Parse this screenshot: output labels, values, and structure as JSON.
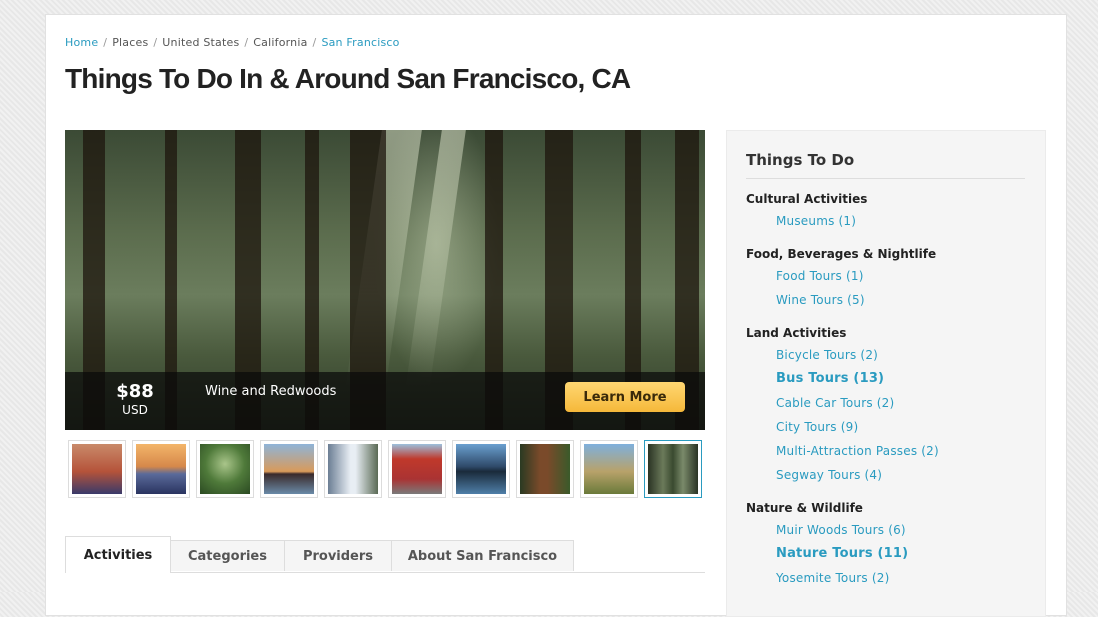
{
  "breadcrumb": {
    "home": "Home",
    "places": "Places",
    "country": "United States",
    "state": "California",
    "city": "San Francisco",
    "separator": "/"
  },
  "page_title": "Things To Do In & Around San Francisco, CA",
  "hero": {
    "price": "$88",
    "currency": "USD",
    "name": "Wine and Redwoods",
    "button_label": "Learn More"
  },
  "thumbnails": [
    {
      "name": "golden-gate-sunset"
    },
    {
      "name": "bay-sunset"
    },
    {
      "name": "forest-tree"
    },
    {
      "name": "bay-bridge"
    },
    {
      "name": "yosemite-falls"
    },
    {
      "name": "cable-car-trolley"
    },
    {
      "name": "mountain-lake"
    },
    {
      "name": "redwood-trail"
    },
    {
      "name": "vineyard-hills"
    },
    {
      "name": "redwood-forest",
      "active": true
    }
  ],
  "tabs": [
    "Activities",
    "Categories",
    "Providers",
    "About San Francisco"
  ],
  "sidebar": {
    "title": "Things To Do",
    "categories": [
      {
        "label": "Cultural Activities",
        "items": [
          {
            "label": "Museums (1)"
          }
        ]
      },
      {
        "label": "Food, Beverages & Nightlife",
        "items": [
          {
            "label": "Food Tours (1)"
          },
          {
            "label": "Wine Tours (5)"
          }
        ]
      },
      {
        "label": "Land Activities",
        "items": [
          {
            "label": "Bicycle Tours (2)"
          },
          {
            "label": "Bus Tours (13)",
            "bold": true
          },
          {
            "label": "Cable Car Tours (2)"
          },
          {
            "label": "City Tours (9)"
          },
          {
            "label": "Multi-Attraction Passes (2)"
          },
          {
            "label": "Segway Tours (4)"
          }
        ]
      },
      {
        "label": "Nature & Wildlife",
        "items": [
          {
            "label": "Muir Woods Tours (6)"
          },
          {
            "label": "Nature Tours (11)",
            "bold": true
          },
          {
            "label": "Yosemite Tours (2)"
          }
        ]
      }
    ]
  },
  "colors": {
    "link": "#2a9bc0",
    "button": "#f5b83a",
    "title": "#222222"
  }
}
